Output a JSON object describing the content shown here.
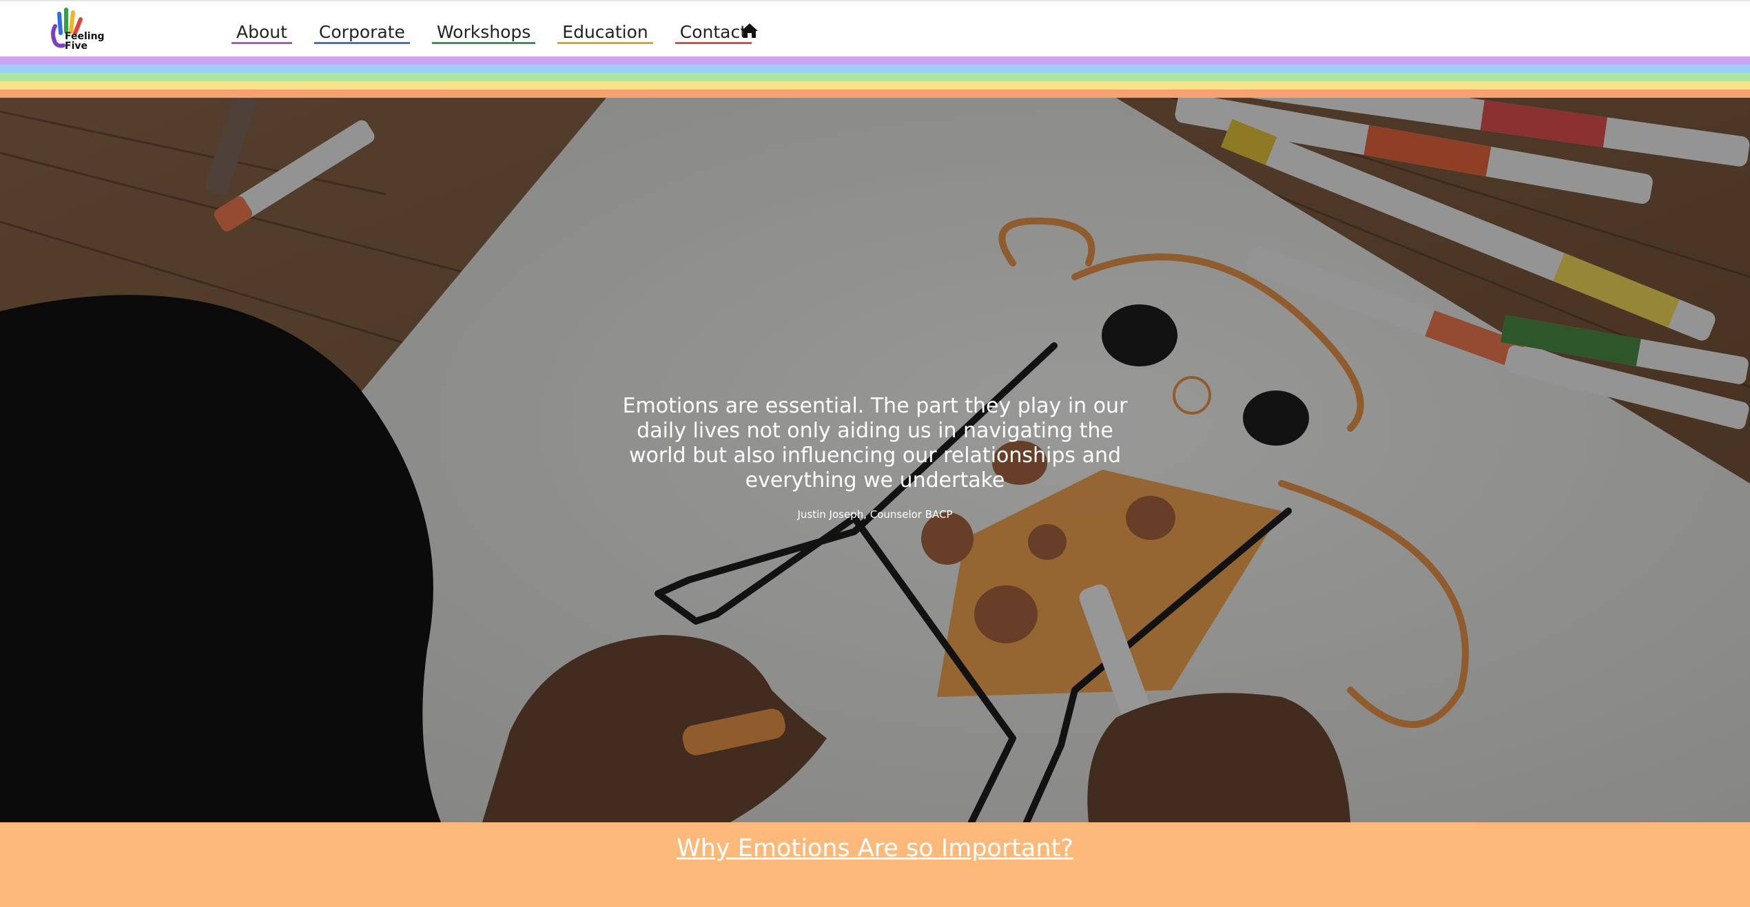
{
  "brand": {
    "logo_text": "Feeling\nFive",
    "logo_icon": "rainbow-hand-icon",
    "hand_colors": [
      "#7b3fc4",
      "#2f6ee0",
      "#2fa24a",
      "#f2b51c",
      "#e0413f"
    ]
  },
  "nav": {
    "items": [
      {
        "label": "About",
        "underline": "#b04fcf"
      },
      {
        "label": "Corporate",
        "underline": "#3d6fd8"
      },
      {
        "label": "Workshops",
        "underline": "#2f9a4b"
      },
      {
        "label": "Education",
        "underline": "#e3a21a"
      },
      {
        "label": "Contact",
        "underline": "#e04848"
      }
    ],
    "home_icon": "home-icon"
  },
  "rainbow_colors": [
    "#cda4f2",
    "#9fcdfb",
    "#a9e6a1",
    "#f8e38b",
    "#f7a070"
  ],
  "hero": {
    "quote": "Emotions are essential. The part they play in our daily lives not only aiding us in navigating the world but also influencing our relationships and everything we undertake",
    "author": "Justin Joseph, Counselor BACP"
  },
  "section": {
    "background": "#fcb97a",
    "link_label": "Why Emotions Are so Important?"
  }
}
